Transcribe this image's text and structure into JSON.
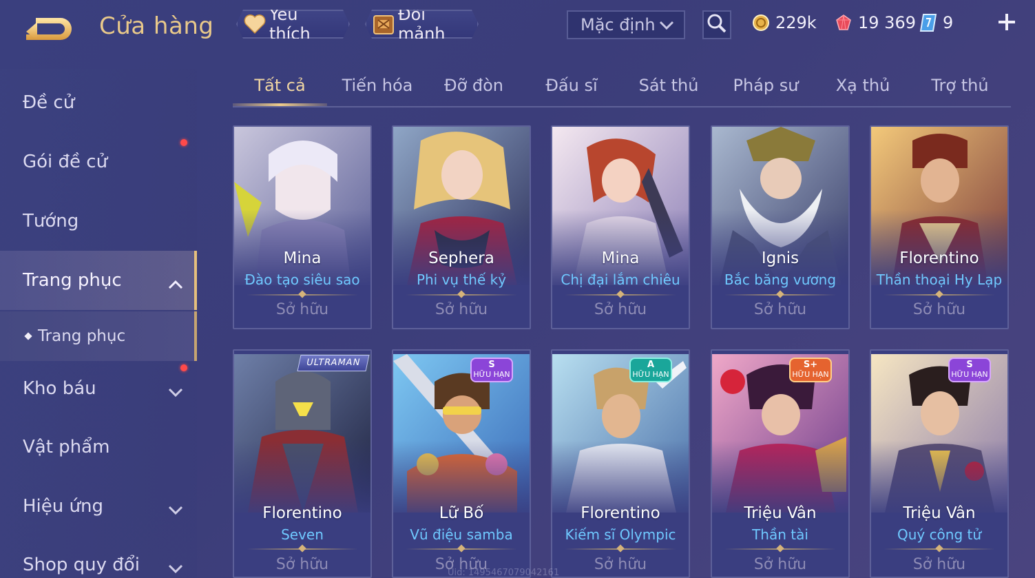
{
  "header": {
    "title": "Cửa hàng",
    "favorite_label": "Yêu thích",
    "exchange_label": "Đổi mảnh",
    "sort_value": "Mặc định",
    "gold": "229k",
    "gems": "19 369",
    "vouchers": "9"
  },
  "sidebar": {
    "items": [
      {
        "label": "Đề cử"
      },
      {
        "label": "Gói đề cử"
      },
      {
        "label": "Tướng"
      },
      {
        "label": "Trang phục"
      },
      {
        "label": "Trang phục"
      },
      {
        "label": "Kho báu"
      },
      {
        "label": "Vật phẩm"
      },
      {
        "label": "Hiệu ứng"
      },
      {
        "label": "Shop quy đổi"
      }
    ]
  },
  "tabs": [
    "Tất cả",
    "Tiến hóa",
    "Đỡ đòn",
    "Đấu sĩ",
    "Sát thủ",
    "Pháp sư",
    "Xạ thủ",
    "Trợ thủ"
  ],
  "owned_label": "Sở hữu",
  "badges": {
    "s": "S",
    "a": "A",
    "splus": "S+",
    "limited": "HỮU HẠN",
    "ultraman": "ULTRAMAN"
  },
  "cards": [
    {
      "hero": "Mina",
      "skin": "Đào tạo siêu sao"
    },
    {
      "hero": "Sephera",
      "skin": "Phi vụ thế kỷ"
    },
    {
      "hero": "Mina",
      "skin": "Chị đại lắm chiêu"
    },
    {
      "hero": "Ignis",
      "skin": "Bắc băng vương"
    },
    {
      "hero": "Florentino",
      "skin": "Thần thoại Hy Lạp"
    },
    {
      "hero": "Florentino",
      "skin": "Seven"
    },
    {
      "hero": "Lữ Bố",
      "skin": "Vũ điệu samba"
    },
    {
      "hero": "Florentino",
      "skin": "Kiếm sĩ Olympic"
    },
    {
      "hero": "Triệu Vân",
      "skin": "Thần tài"
    },
    {
      "hero": "Triệu Vân",
      "skin": "Quý công tử"
    }
  ],
  "uid": "Uid: 1495467079042161",
  "colors": {
    "accent_gold": "#e9c98a",
    "skin_blue": "#6fc9ff",
    "badge_s": "#8b45d8",
    "badge_a": "#1aa69a",
    "badge_splus": "#e5632f"
  }
}
